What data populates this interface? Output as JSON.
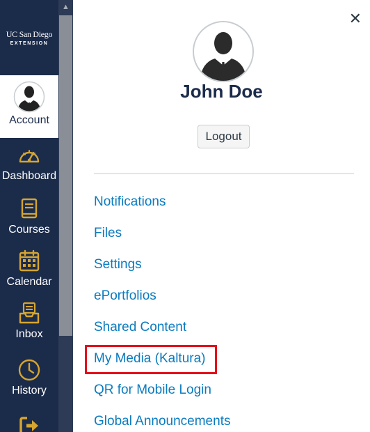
{
  "logo": {
    "line1": "UC San Diego",
    "line2": "EXTENSION"
  },
  "nav": {
    "account": "Account",
    "dashboard": "Dashboard",
    "courses": "Courses",
    "calendar": "Calendar",
    "inbox": "Inbox",
    "history": "History"
  },
  "tray": {
    "user_name": "John Doe",
    "logout": "Logout",
    "close_icon": "close-icon",
    "links": [
      "Notifications",
      "Files",
      "Settings",
      "ePortfolios",
      "Shared Content",
      "My Media (Kaltura)",
      "QR for Mobile Login",
      "Global Announcements"
    ]
  },
  "colors": {
    "nav_bg": "#1b2b4a",
    "icon_gold": "#d6a52f",
    "link": "#0a7bbf",
    "highlight": "#e5101a"
  }
}
